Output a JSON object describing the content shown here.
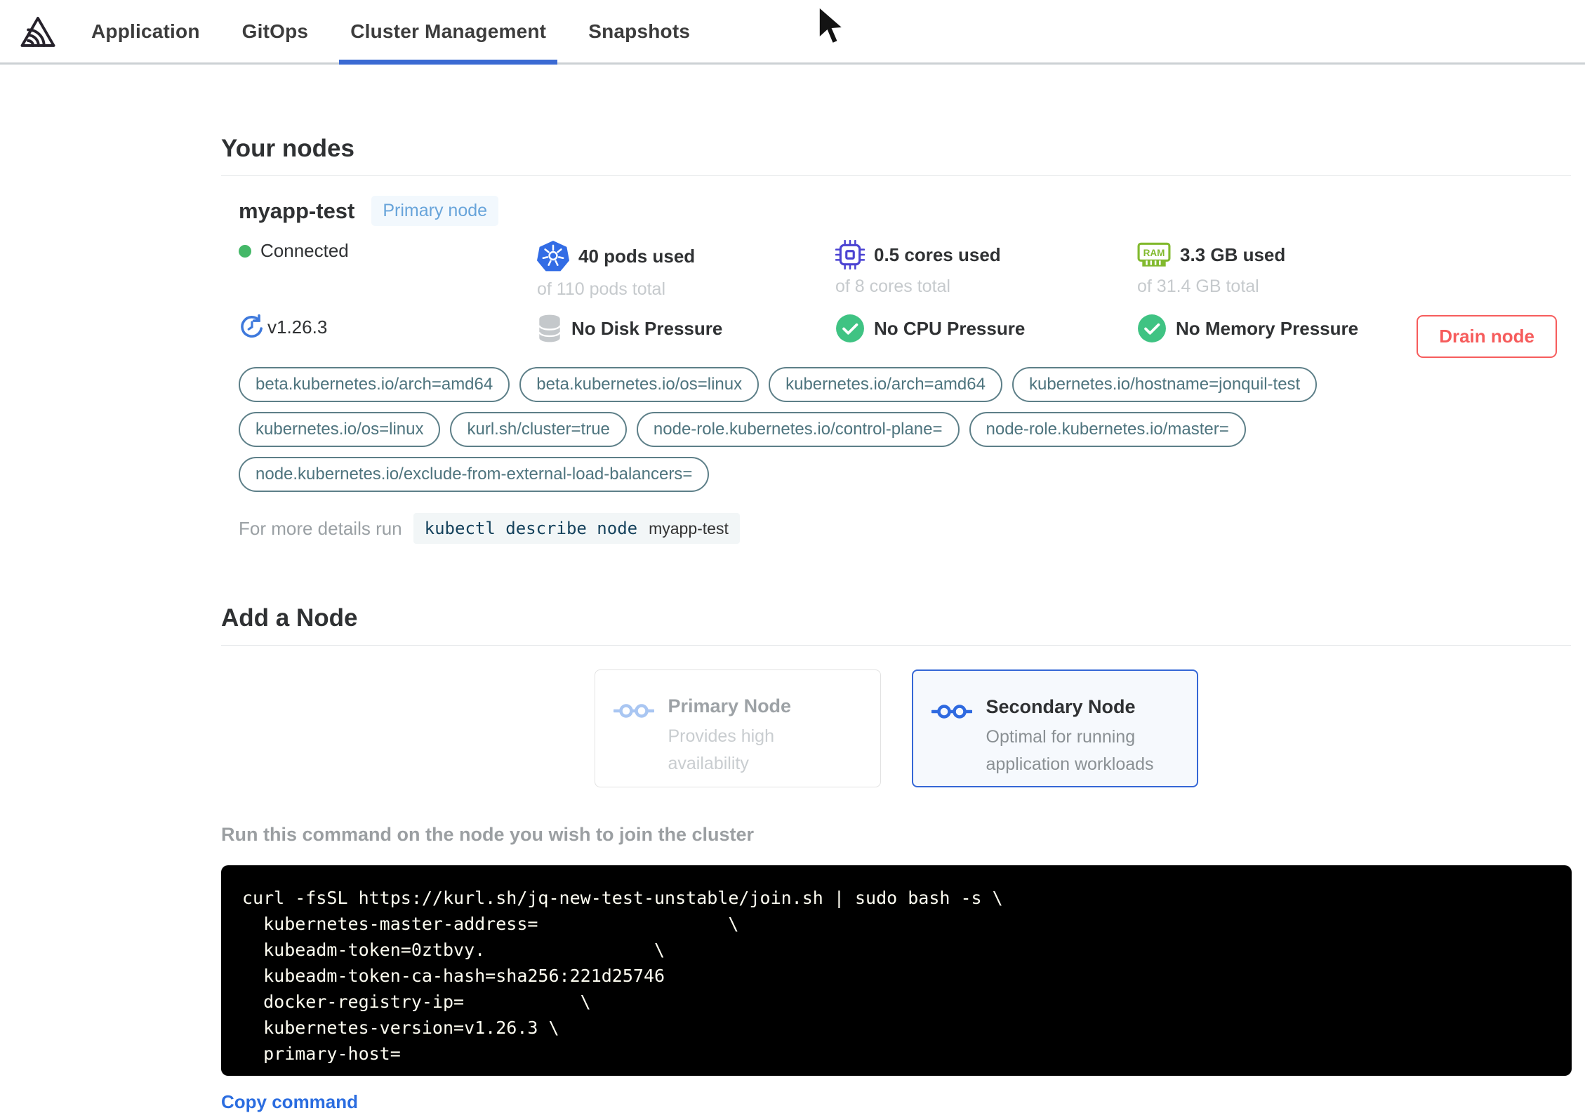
{
  "colors": {
    "accent_blue": "#3b6ad3",
    "kubernetes_blue": "#326ce5",
    "connected_green": "#44b868",
    "check_green": "#3fc383",
    "cpu_purple": "#4b43d2",
    "ram_green": "#82ba2f",
    "drain_red": "#f65c5c",
    "tag_teal": "#5d7f88",
    "badge_blue": "#68a4da",
    "link_blue": "#2b6de0"
  },
  "icons": {
    "logo": "triangle-spiral-logo",
    "pods": "kubernetes-helm-icon",
    "cores": "cpu-chip-icon",
    "memory": "ram-stick-icon",
    "version": "update-clock-icon",
    "disk": "database-cylinder-icon",
    "check": "check-circle-icon",
    "node_link": "linked-nodes-icon",
    "cursor": "mouse-pointer"
  },
  "nav": {
    "tabs": [
      {
        "label": "Application",
        "active": false
      },
      {
        "label": "GitOps",
        "active": false
      },
      {
        "label": "Cluster Management",
        "active": true
      },
      {
        "label": "Snapshots",
        "active": false
      }
    ]
  },
  "your_nodes": {
    "heading": "Your nodes",
    "node": {
      "name": "myapp-test",
      "badge": "Primary node",
      "status": "Connected",
      "version": "v1.26.3",
      "pods": {
        "used": "40 pods used",
        "total": "of 110 pods total"
      },
      "cores": {
        "used": "0.5 cores used",
        "total": "of 8 cores total"
      },
      "memory": {
        "used": "3.3 GB used",
        "total": "of 31.4 GB total"
      },
      "conditions": {
        "disk": "No Disk Pressure",
        "cpu": "No CPU Pressure",
        "memory": "No Memory Pressure"
      },
      "drain_button": "Drain node",
      "labels": [
        "beta.kubernetes.io/arch=amd64",
        "beta.kubernetes.io/os=linux",
        "kubernetes.io/arch=amd64",
        "kubernetes.io/hostname=jonquil-test",
        "kubernetes.io/os=linux",
        "kurl.sh/cluster=true",
        "node-role.kubernetes.io/control-plane=",
        "node-role.kubernetes.io/master=",
        "node.kubernetes.io/exclude-from-external-load-balancers="
      ],
      "details": {
        "prefix": "For more details run",
        "command": "kubectl describe node",
        "node_name": "myapp-test"
      }
    }
  },
  "add_node": {
    "heading": "Add a Node",
    "cards": [
      {
        "title": "Primary Node",
        "subtitle": "Provides high availability"
      },
      {
        "title": "Secondary Node",
        "subtitle": "Optimal for running application workloads"
      }
    ],
    "instruction": "Run this command on the node you wish to join the cluster",
    "join_command": "curl -fsSL https://kurl.sh/jq-new-test-unstable/join.sh | sudo bash -s \\\n  kubernetes-master-address=                  \\\n  kubeadm-token=0ztbvy.                \\\n  kubeadm-token-ca-hash=sha256:221d25746\n  docker-registry-ip=           \\\n  kubernetes-version=v1.26.3 \\\n  primary-host=",
    "copy_label": "Copy command"
  }
}
